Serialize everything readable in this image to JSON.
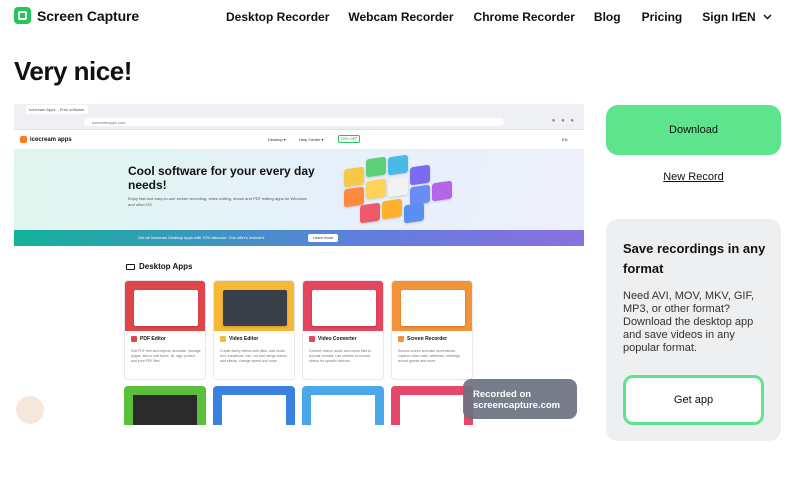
{
  "brand": {
    "name": "Screen Capture",
    "accent": "#5de48d",
    "icon": "screen-capture-logo-icon"
  },
  "nav": {
    "links": [
      "Desktop Recorder",
      "Webcam Recorder",
      "Chrome Recorder",
      "Blog",
      "Pricing",
      "Sign In"
    ],
    "language": "EN",
    "language_icon": "chevron-down-icon"
  },
  "page": {
    "title": "Very nice!"
  },
  "recording_preview": {
    "browser": {
      "tab_title": "Icecream Apps – Free software",
      "url": "icecreamapps.com"
    },
    "site": {
      "logo": "icecream apps",
      "menu": [
        "Desktop ▾",
        "Help Center ▾"
      ],
      "sale_badge": "70% OFF",
      "language": "EN",
      "hero_title": "Cool software for your every day needs!",
      "hero_subtitle": "Enjoy fast and easy-to-use screen recording, video editing, ebook and PDF editing apps for Windows and other OS",
      "promo_text": "Get all Icecream Desktop Apps with 70% discount. One offer's included.",
      "promo_button": "Learn more",
      "section_title": "Desktop Apps",
      "apps": [
        {
          "name": "PDF Editor",
          "desc": "Edit PDF text and objects, annotate, manage pages, add or edit forms, fill, sign, protect and print PDF files.",
          "color": "#e0454a"
        },
        {
          "name": "Video Editor",
          "desc": "Create family videos with titles. Add music, text, transitions, trim, cut and merge videos, add effects, change speed and more.",
          "color": "#f5b935"
        },
        {
          "name": "Video Converter",
          "desc": "Convert videos, audio and movie files to popular formats. Use presets to convert videos for specific devices.",
          "color": "#e64560"
        },
        {
          "name": "Screen Recorder",
          "desc": "Record screen and take screenshots. Capture video calls, webinars, meetings, record games and more.",
          "color": "#f2933b"
        }
      ]
    },
    "overlay": "Recorded on screencapture.com"
  },
  "actions": {
    "download": "Download",
    "new_record": "New Record"
  },
  "promo_card": {
    "title": "Save recordings in any format",
    "text": "Need AVI, MOV, MKV, GIF, MP3, or other format? Download the desktop app and save videos in any popular format.",
    "button": "Get app"
  }
}
